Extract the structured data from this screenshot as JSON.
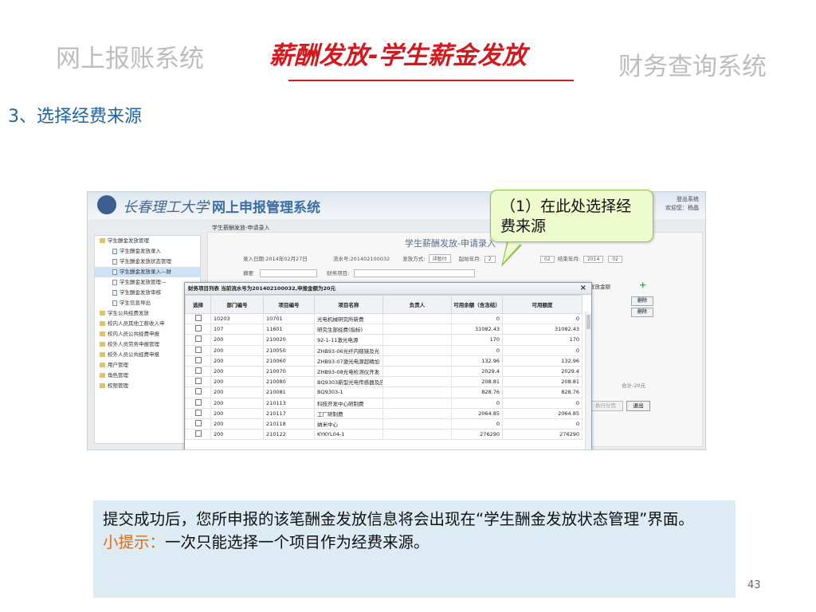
{
  "slide": {
    "nav_left": "网上报账系统",
    "nav_center": "薪酬发放-学生薪金发放",
    "nav_right": "财务查询系统",
    "step_heading": "3、选择经费来源",
    "page_number": "43"
  },
  "callout": {
    "text": "（1）在此处选择经费来源"
  },
  "info": {
    "line1": "提交成功后，您所申报的该笔酬金发放信息将会出现在“学生酬金发放状态管理”界面。",
    "tip_label": "小提示：",
    "tip_text": "一次只能选择一个项目作为经费来源。"
  },
  "app": {
    "school_name": "长春理工大学",
    "system_name": "网上申报管理系统",
    "top_links": {
      "logout": "登出系统",
      "user": "欢迎您：杨晶"
    },
    "breadcrumb": "学生薪酬发放-申请录入",
    "sidebar": [
      {
        "label": "学生酬金发放管理",
        "level": 0
      },
      {
        "label": "学生酬金发放录入",
        "level": 1
      },
      {
        "label": "学生酬金发放状态管理",
        "level": 1
      },
      {
        "label": "学生酬金发放录入—财",
        "level": 1,
        "active": true
      },
      {
        "label": "学生酬金发放管理—",
        "level": 1
      },
      {
        "label": "学生酬金发放审核",
        "level": 1
      },
      {
        "label": "学生信息导出",
        "level": 1
      },
      {
        "label": "学生公共经费发放",
        "level": 0
      },
      {
        "label": "校内人员其他工薪收入申",
        "level": 0
      },
      {
        "label": "校内人员公共经费申报",
        "level": 0
      },
      {
        "label": "校外人员劳务申报管理",
        "level": 0
      },
      {
        "label": "校外人员公共经费申报",
        "level": 0
      },
      {
        "label": "用户管理",
        "level": 0
      },
      {
        "label": "角色管理",
        "level": 0
      },
      {
        "label": "权限管理",
        "level": 0
      }
    ],
    "form": {
      "title": "学生薪酬发放-申请录入",
      "entry_date": "录入日期:2014年02月27日",
      "serial_no": "流水号:201402100032",
      "pay_method_label": "发放方式:",
      "pay_method_value": "冲暂付",
      "start_label": "起始年月:",
      "start_year": "2",
      "start_month": "02",
      "end_label": "结束年月:",
      "end_year": "2014",
      "end_month": "02",
      "summary_label": "摘要",
      "finance_item_label": "财务项目:"
    },
    "side": {
      "amount_label": "发放金额",
      "delete_1": "删除",
      "delete_2": "删除",
      "total": "合计:20元",
      "page_btn": "执行分页",
      "exit": "退出"
    },
    "dialog": {
      "title": "财务项目列表 当前流水号为201402100032,申报金额为20元",
      "close": "×",
      "headers": [
        "选择",
        "部门编号",
        "项目编号",
        "项目名称",
        "负责人",
        "可用余额（含冻结）",
        "可用额度"
      ],
      "rows": [
        [
          "10203",
          "10701",
          "光电机械研究所新费",
          "",
          "0",
          "0"
        ],
        [
          "107",
          "11601",
          "研究生部经费(指标)",
          "",
          "31082.43",
          "31082.43"
        ],
        [
          "200",
          "210020",
          "92-1-11激光电源",
          "",
          "170",
          "170"
        ],
        [
          "200",
          "210050",
          "ZHB93-06光纤内窥镜及光",
          "",
          "0",
          "0"
        ],
        [
          "200",
          "210060",
          "ZHB93-07激光电源超精加",
          "",
          "132.96",
          "132.96"
        ],
        [
          "200",
          "210070",
          "ZHB93-08光电检测仪开发",
          "",
          "2029.4",
          "2029.4"
        ],
        [
          "200",
          "210080",
          "BQ9303新型光电传感器及应",
          "",
          "208.81",
          "208.81"
        ],
        [
          "200",
          "210081",
          "BQ9303-1",
          "",
          "828.76",
          "828.76"
        ],
        [
          "200",
          "210113",
          "科技开发中心研制费",
          "",
          "0",
          "0"
        ],
        [
          "200",
          "210117",
          "工厂研制费",
          "",
          "2064.85",
          "2064.85"
        ],
        [
          "200",
          "210118",
          "纳米中心",
          "",
          "0",
          "0"
        ],
        [
          "200",
          "210122",
          "KYKYL04-1",
          "",
          "276290",
          "276290"
        ]
      ]
    }
  }
}
